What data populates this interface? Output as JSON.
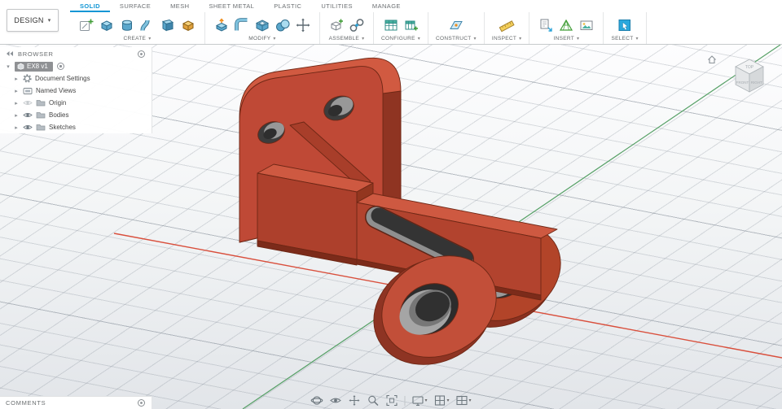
{
  "header": {
    "design_menu": {
      "label": "DESIGN"
    },
    "tabs": [
      {
        "label": "SOLID",
        "active": true
      },
      {
        "label": "SURFACE",
        "active": false
      },
      {
        "label": "MESH",
        "active": false
      },
      {
        "label": "SHEET METAL",
        "active": false
      },
      {
        "label": "PLASTIC",
        "active": false
      },
      {
        "label": "UTILITIES",
        "active": false
      },
      {
        "label": "MANAGE",
        "active": false
      }
    ],
    "groups": [
      {
        "label": "CREATE",
        "icons": [
          "create-sketch-icon",
          "extrude-icon",
          "revolve-icon",
          "sweep-icon",
          "loft-icon",
          "primitive-box-icon"
        ]
      },
      {
        "label": "MODIFY",
        "icons": [
          "press-pull-icon",
          "fillet-icon",
          "shell-icon",
          "combine-icon",
          "move-copy-icon"
        ]
      },
      {
        "label": "ASSEMBLE",
        "icons": [
          "new-component-icon",
          "joint-icon"
        ]
      },
      {
        "label": "CONFIGURE",
        "icons": [
          "configuration-table-icon",
          "configure-features-icon"
        ]
      },
      {
        "label": "CONSTRUCT",
        "icons": [
          "construction-plane-icon"
        ]
      },
      {
        "label": "INSPECT",
        "icons": [
          "measure-icon"
        ]
      },
      {
        "label": "INSERT",
        "icons": [
          "insert-derive-icon",
          "insert-mesh-icon",
          "decal-icon"
        ]
      },
      {
        "label": "SELECT",
        "icons": [
          "select-window-icon"
        ]
      }
    ]
  },
  "browser": {
    "title": "BROWSER",
    "document": {
      "label": "EX8 v1",
      "selected": true,
      "icon": "component-icon",
      "activate_icon": "radio-icon"
    },
    "items": [
      {
        "label": "Document Settings",
        "icon": "gear-icon"
      },
      {
        "label": "Named Views",
        "icon": "named-views-icon"
      },
      {
        "label": "Origin",
        "icon": "folder-icon",
        "eye": "hidden"
      },
      {
        "label": "Bodies",
        "icon": "folder-icon",
        "eye": "visible"
      },
      {
        "label": "Sketches",
        "icon": "folder-icon",
        "eye": "visible"
      }
    ]
  },
  "viewport": {
    "viewcube": {
      "top_label": "TOP",
      "front_label": "FRONT",
      "right_label": "RIGHT"
    },
    "axes": {
      "x_axis_color": "#d94f3c",
      "y_axis_color": "#56a066"
    },
    "model": {
      "part_color": "#bf4936",
      "description": "red clevis bracket: rounded plate with two holes, rib, stepped arm with angled slot, double eye bosses with bore"
    }
  },
  "comments": {
    "title": "COMMENTS"
  },
  "navbar": {
    "icons": [
      "orbit-icon",
      "look-at-icon",
      "pan-icon",
      "zoom-icon",
      "fit-icon",
      "display-settings-icon",
      "grid-snaps-icon",
      "viewports-icon"
    ]
  }
}
